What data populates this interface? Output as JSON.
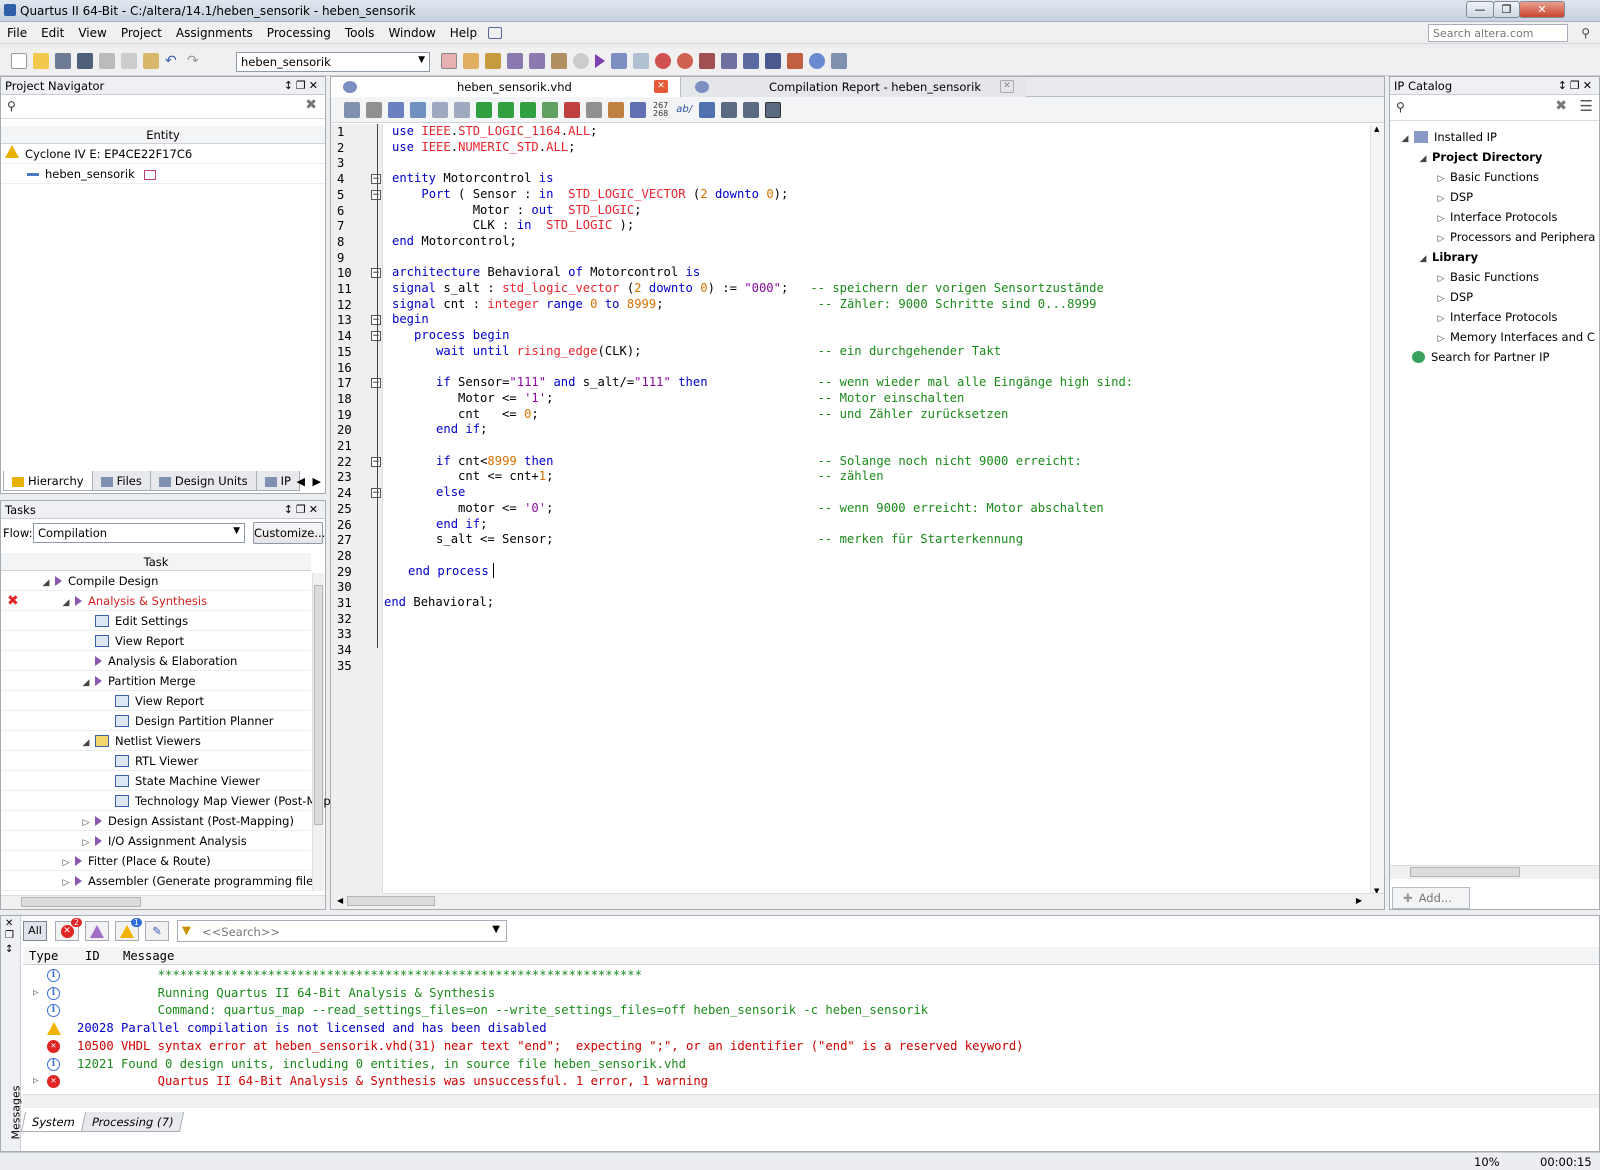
{
  "window": {
    "title": "Quartus II 64-Bit - C:/altera/14.1/heben_sensorik - heben_sensorik"
  },
  "menu": [
    "File",
    "Edit",
    "View",
    "Project",
    "Assignments",
    "Processing",
    "Tools",
    "Window",
    "Help"
  ],
  "search": {
    "placeholder": "Search altera.com"
  },
  "toolbar": {
    "project_combo": "heben_sensorik"
  },
  "project_navigator": {
    "title": "Project Navigator",
    "column": "Entity",
    "device": "Cyclone IV E: EP4CE22F17C6",
    "top_entity": "heben_sensorik",
    "tabs": [
      "Hierarchy",
      "Files",
      "Design Units",
      "IP"
    ]
  },
  "tasks": {
    "title": "Tasks",
    "flow_label": "Flow:",
    "flow_value": "Compilation",
    "customize": "Customize...",
    "column": "Task",
    "items": [
      {
        "label": "Compile Design",
        "indent": 0
      },
      {
        "label": "Analysis & Synthesis",
        "indent": 1,
        "error": true
      },
      {
        "label": "Edit Settings",
        "indent": 2
      },
      {
        "label": "View Report",
        "indent": 2
      },
      {
        "label": "Analysis & Elaboration",
        "indent": 2
      },
      {
        "label": "Partition Merge",
        "indent": 2
      },
      {
        "label": "View Report",
        "indent": 3
      },
      {
        "label": "Design Partition Planner",
        "indent": 3
      },
      {
        "label": "Netlist Viewers",
        "indent": 2
      },
      {
        "label": "RTL Viewer",
        "indent": 3
      },
      {
        "label": "State Machine Viewer",
        "indent": 3
      },
      {
        "label": "Technology Map Viewer (Post-Mapp",
        "indent": 3
      },
      {
        "label": "Design Assistant (Post-Mapping)",
        "indent": 2
      },
      {
        "label": "I/O Assignment Analysis",
        "indent": 2
      },
      {
        "label": "Fitter (Place & Route)",
        "indent": 1
      },
      {
        "label": "Assembler (Generate programming files)",
        "indent": 1
      }
    ]
  },
  "editor_tabs": [
    {
      "label": "heben_sensorik.vhd",
      "active": true
    },
    {
      "label": "Compilation Report - heben_sensorik",
      "active": false
    }
  ],
  "code_lines": [
    "use IEEE.STD_LOGIC_1164.ALL;",
    "use IEEE.NUMERIC_STD.ALL;",
    "",
    "entity Motorcontrol is",
    "    Port ( Sensor : in  STD_LOGIC_VECTOR (2 downto 0);",
    "           Motor : out  STD_LOGIC;",
    "           CLK : in  STD_LOGIC );",
    "end Motorcontrol;",
    "",
    "architecture Behavioral of Motorcontrol is",
    "signal s_alt : std_logic_vector (2 downto 0) := \"000\";   -- speichern der vorigen Sensortzustände",
    "signal cnt : integer range 0 to 8999;                     -- Zähler: 9000 Schritte sind 0...8999",
    "begin",
    "   process begin",
    "      wait until rising_edge(CLK);                        -- ein durchgehender Takt",
    "",
    "      if Sensor=\"111\" and s_alt/=\"111\" then               -- wenn wieder mal alle Eingänge high sind:",
    "         Motor <= '1';                                    -- Motor einschalten",
    "         cnt   <= 0;                                      -- und Zähler zurücksetzen",
    "      end if;",
    "",
    "      if cnt<8999 then                                    -- Solange noch nicht 9000 erreicht:",
    "         cnt <= cnt+1;                                    -- zählen",
    "      else",
    "         motor <= '0';                                    -- wenn 9000 erreicht: Motor abschalten",
    "      end if;",
    "      s_alt <= Sensor;                                    -- merken für Starterkennung",
    "",
    "  end process",
    "",
    "end Behavioral;",
    "",
    "",
    "",
    ""
  ],
  "ip_catalog": {
    "title": "IP Catalog",
    "add": "Add...",
    "items": [
      {
        "label": "Installed IP",
        "indent": 0
      },
      {
        "label": "Project Directory",
        "indent": 1,
        "bold": true
      },
      {
        "label": "Basic Functions",
        "indent": 2
      },
      {
        "label": "DSP",
        "indent": 2
      },
      {
        "label": "Interface Protocols",
        "indent": 2
      },
      {
        "label": "Processors and Periphera",
        "indent": 2
      },
      {
        "label": "Library",
        "indent": 1,
        "bold": true
      },
      {
        "label": "Basic Functions",
        "indent": 2
      },
      {
        "label": "DSP",
        "indent": 2
      },
      {
        "label": "Interface Protocols",
        "indent": 2
      },
      {
        "label": "Memory Interfaces and C",
        "indent": 2
      },
      {
        "label": "Search for Partner IP",
        "indent": 0
      }
    ]
  },
  "messages": {
    "filter_all": "All",
    "search_placeholder": "<<Search>>",
    "err_count": "2",
    "info_count": "1",
    "cols": {
      "type": "Type",
      "id": "ID",
      "message": "Message"
    },
    "rows": [
      {
        "type": "info",
        "id": "",
        "text": "     ******************************************************************",
        "color": "#1a8a1a"
      },
      {
        "type": "info",
        "id": "",
        "text": "     Running Quartus II 64-Bit Analysis & Synthesis",
        "color": "#1a8a1a",
        "expand": true
      },
      {
        "type": "info",
        "id": "",
        "text": "     Command: quartus_map --read_settings_files=on --write_settings_files=off heben_sensorik -c heben_sensorik",
        "color": "#1a8a1a"
      },
      {
        "type": "warn",
        "id": "20028",
        "text": "Parallel compilation is not licensed and has been disabled",
        "color": "#0000c8"
      },
      {
        "type": "err",
        "id": "10500",
        "text": "VHDL syntax error at heben_sensorik.vhd(31) near text \"end\";  expecting \";\", or an identifier (\"end\" is a reserved keyword)",
        "color": "#d00000"
      },
      {
        "type": "info",
        "id": "12021",
        "text": "Found 0 design units, including 0 entities, in source file heben_sensorik.vhd",
        "color": "#1a8a1a"
      },
      {
        "type": "err",
        "id": "",
        "text": "     Quartus II 64-Bit Analysis & Synthesis was unsuccessful. 1 error, 1 warning",
        "color": "#d00000",
        "expand": true
      }
    ],
    "side_label": "Messages",
    "tabs": [
      "System",
      "Processing (7)"
    ]
  },
  "status": {
    "zoom": "10%",
    "time": "00:00:15"
  },
  "colors": {
    "keyword": "#0000c8",
    "type": "#e8242e",
    "number": "#d87000",
    "string": "#8b0aa0",
    "comment": "#1a8a1a"
  }
}
